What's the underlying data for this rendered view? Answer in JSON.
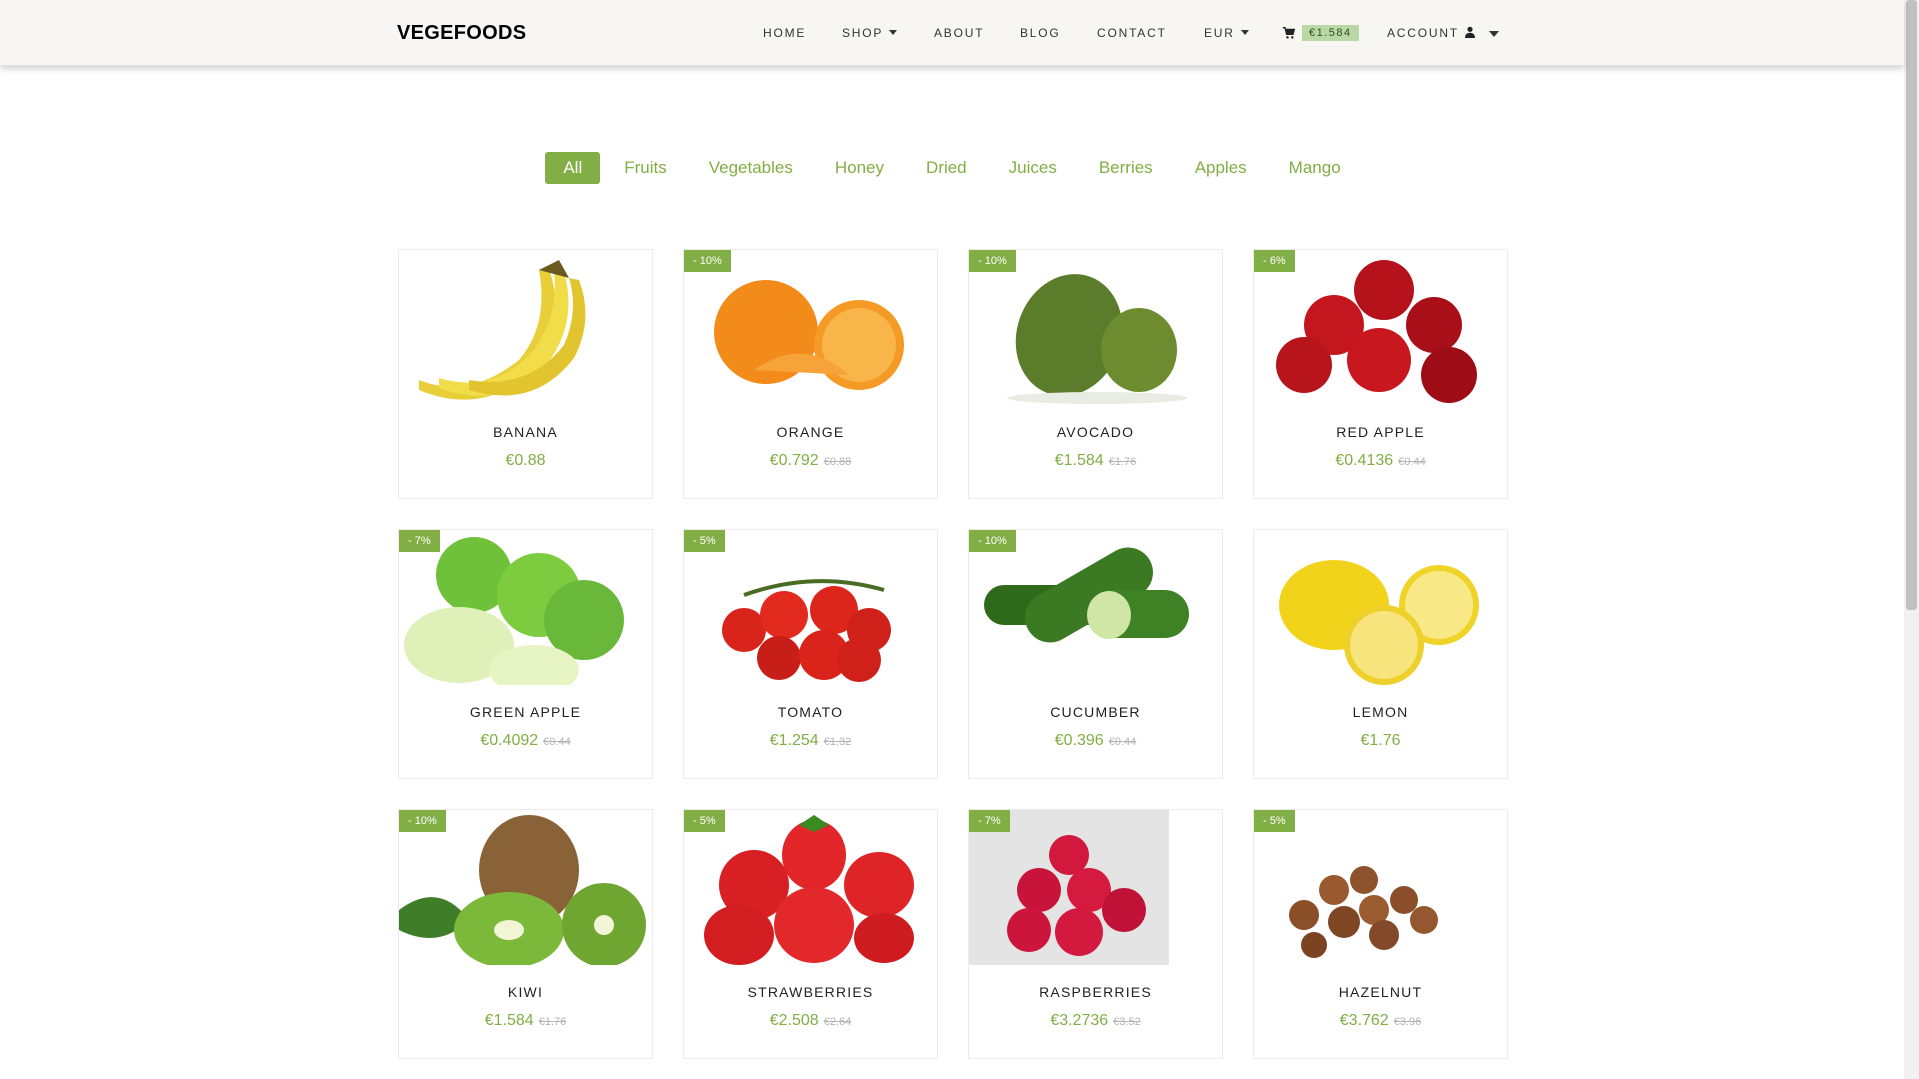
{
  "nav": {
    "brand": "VEGEFOODS",
    "home": "HOME",
    "shop": "SHOP",
    "about": "ABOUT",
    "blog": "BLOG",
    "contact": "CONTACT",
    "currency": "EUR",
    "cart_total": "€1.584",
    "account": "ACCOUNT"
  },
  "filters": [
    "All",
    "Fruits",
    "Vegetables",
    "Honey",
    "Dried",
    "Juices",
    "Berries",
    "Apples",
    "Mango"
  ],
  "active_filter": "All",
  "colors": {
    "accent": "#82ae46",
    "navbar_bg": "#f7f6f2"
  },
  "products": [
    {
      "name": "BANANA",
      "badge": "",
      "price": "€0.88",
      "old": ""
    },
    {
      "name": "ORANGE",
      "badge": "- 10%",
      "price": "€0.792",
      "old": "€0.88"
    },
    {
      "name": "AVOCADO",
      "badge": "- 10%",
      "price": "€1.584",
      "old": "€1.76"
    },
    {
      "name": "RED APPLE",
      "badge": "- 6%",
      "price": "€0.4136",
      "old": "€0.44"
    },
    {
      "name": "GREEN APPLE",
      "badge": "- 7%",
      "price": "€0.4092",
      "old": "€0.44"
    },
    {
      "name": "TOMATO",
      "badge": "- 5%",
      "price": "€1.254",
      "old": "€1.32"
    },
    {
      "name": "CUCUMBER",
      "badge": "- 10%",
      "price": "€0.396",
      "old": "€0.44"
    },
    {
      "name": "LEMON",
      "badge": "",
      "price": "€1.76",
      "old": ""
    },
    {
      "name": "KIWI",
      "badge": "- 10%",
      "price": "€1.584",
      "old": "€1.76"
    },
    {
      "name": "STRAWBERRIES",
      "badge": "- 5%",
      "price": "€2.508",
      "old": "€2.64"
    },
    {
      "name": "RASPBERRIES",
      "badge": "- 7%",
      "price": "€3.2736",
      "old": "€3.52"
    },
    {
      "name": "HAZELNUT",
      "badge": "- 5%",
      "price": "€3.762",
      "old": "€3.96"
    }
  ]
}
